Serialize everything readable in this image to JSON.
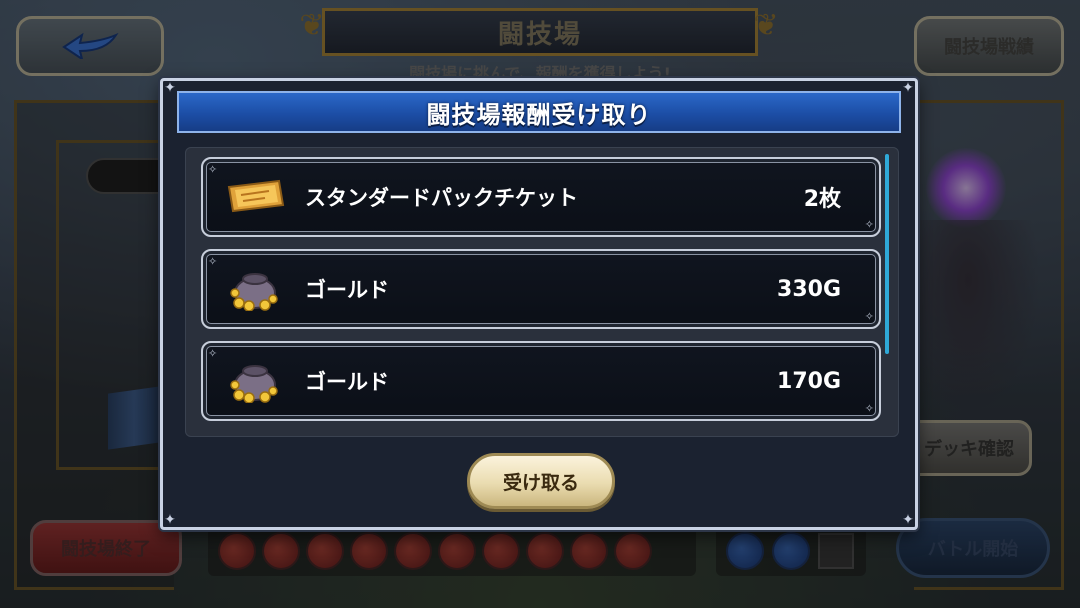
{
  "screen": {
    "title": "闘技場",
    "subtitle": "闘技場に挑んで、報酬を獲得しよう!",
    "record_button": "闘技場戦績",
    "deck_button": "デッキ確認",
    "end_button": "闘技場終了",
    "start_button": "バトル開始",
    "hp_slot_count": 10,
    "mp_slot_count": 3
  },
  "modal": {
    "title": "闘技場報酬受け取り",
    "receive_button": "受け取る",
    "rewards": [
      {
        "icon": "ticket-icon",
        "name": "スタンダードパックチケット",
        "quantity": "2枚"
      },
      {
        "icon": "gold-bag-icon",
        "name": "ゴールド",
        "quantity": "330G"
      },
      {
        "icon": "gold-bag-icon",
        "name": "ゴールド",
        "quantity": "170G"
      }
    ]
  },
  "colors": {
    "header_blue": "#1c4ea6",
    "scroll_accent": "#2fa9d8",
    "button_cream": "#eadcb0"
  }
}
